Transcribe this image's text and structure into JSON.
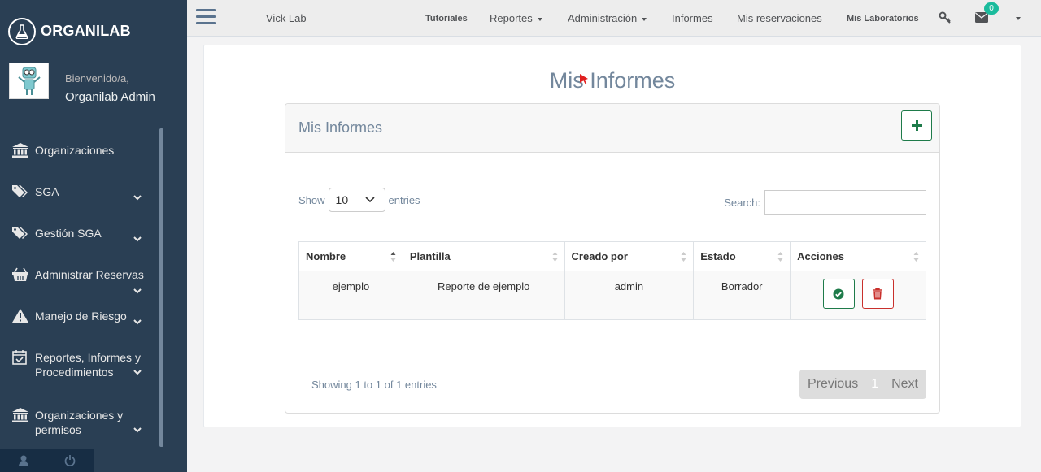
{
  "brand": {
    "name": "ORGANILAB"
  },
  "profile": {
    "welcome": "Bienvenido/a,",
    "name": "Organilab Admin"
  },
  "sidebar": {
    "items": [
      {
        "label": "Organizaciones",
        "icon": "bank-icon",
        "has_submenu": false
      },
      {
        "label": "SGA",
        "icon": "tags-icon",
        "has_submenu": true
      },
      {
        "label": "Gestión SGA",
        "icon": "tags-icon",
        "has_submenu": true
      },
      {
        "label": "Administrar Reservas",
        "icon": "basket-icon",
        "has_submenu": true
      },
      {
        "label": "Manejo de Riesgo",
        "icon": "warning-icon",
        "has_submenu": true
      },
      {
        "label": "Reportes, Informes y Procedimientos",
        "icon": "calendar-check-icon",
        "has_submenu": true
      },
      {
        "label": "Organizaciones y permisos",
        "icon": "bank-icon",
        "has_submenu": true
      }
    ]
  },
  "topnav": {
    "lab": "Vick Lab",
    "tutoriales": "Tutoriales",
    "reportes": "Reportes",
    "administracion": "Administración",
    "informes": "Informes",
    "reservaciones": "Mis reservaciones",
    "laboratorios": "Mis Laboratorios",
    "notification_count": "0"
  },
  "page": {
    "title": "Mis Informes"
  },
  "card": {
    "title": "Mis Informes"
  },
  "table_controls": {
    "show_label": "Show",
    "entries_value": "10",
    "entries_label": "entries",
    "search_label": "Search:",
    "search_value": ""
  },
  "table": {
    "columns": [
      "Nombre",
      "Plantilla",
      "Creado por",
      "Estado",
      "Acciones"
    ],
    "rows": [
      {
        "nombre": "ejemplo",
        "plantilla": "Reporte de ejemplo",
        "creado_por": "admin",
        "estado": "Borrador"
      }
    ]
  },
  "footer": {
    "info": "Showing 1 to 1 of 1 entries",
    "previous": "Previous",
    "current_page": "1",
    "next": "Next"
  },
  "colors": {
    "sidebar": "#2a3f54",
    "accent_green": "#1e7b4a",
    "danger_red": "#c9302c",
    "badge": "#1abb9c"
  }
}
